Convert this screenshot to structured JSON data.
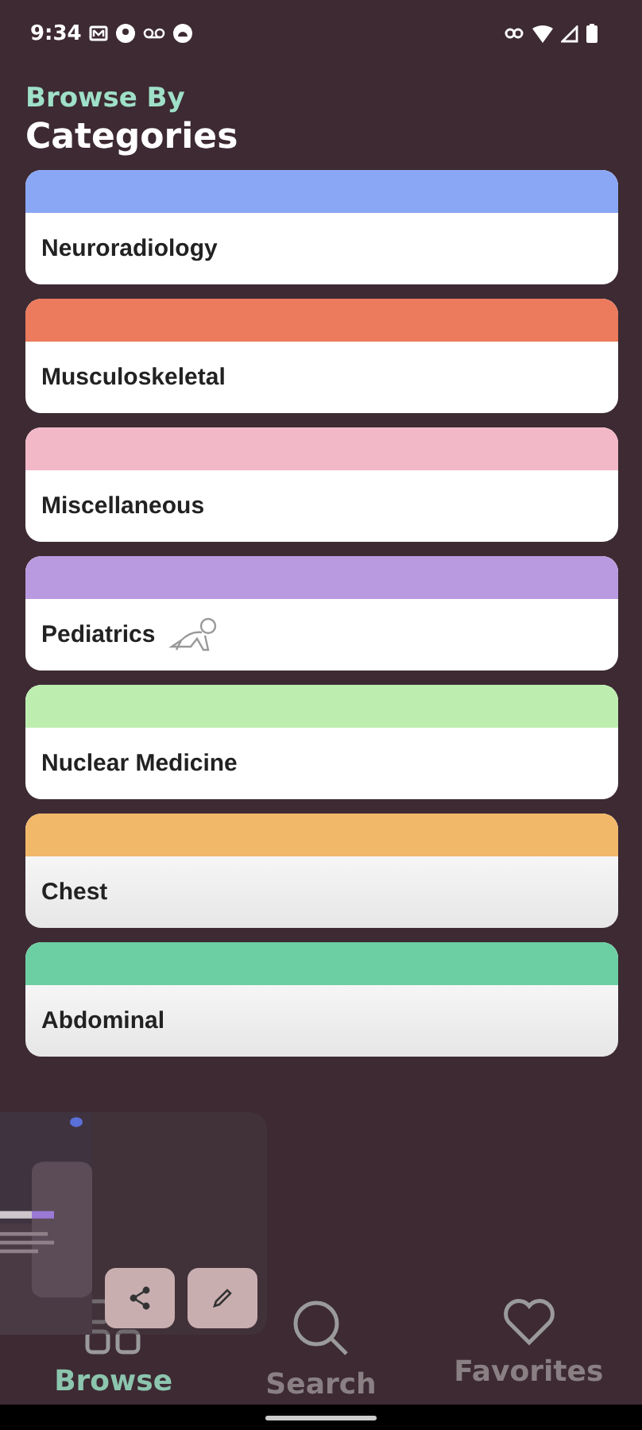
{
  "status_bar": {
    "time": "9:34"
  },
  "header": {
    "subtitle": "Browse By",
    "title": "Categories"
  },
  "categories": [
    {
      "label": "Neuroradiology",
      "color": "#8aa7f5",
      "fade": false,
      "has_icon": false
    },
    {
      "label": "Musculoskeletal",
      "color": "#ec7a5c",
      "fade": false,
      "has_icon": false
    },
    {
      "label": "Miscellaneous",
      "color": "#f3b8c8",
      "fade": false,
      "has_icon": false
    },
    {
      "label": "Pediatrics",
      "color": "#b99ae0",
      "fade": false,
      "has_icon": true
    },
    {
      "label": "Nuclear Medicine",
      "color": "#bdeeb0",
      "fade": false,
      "has_icon": false
    },
    {
      "label": "Chest",
      "color": "#f2b86a",
      "fade": true,
      "has_icon": false
    },
    {
      "label": "Abdominal",
      "color": "#6ccfa3",
      "fade": true,
      "has_icon": false
    }
  ],
  "nav": [
    {
      "label": "Browse",
      "kind": "grid",
      "selected": true
    },
    {
      "label": "Search",
      "kind": "search",
      "selected": false
    },
    {
      "label": "Favorites",
      "kind": "heart",
      "selected": false
    }
  ]
}
